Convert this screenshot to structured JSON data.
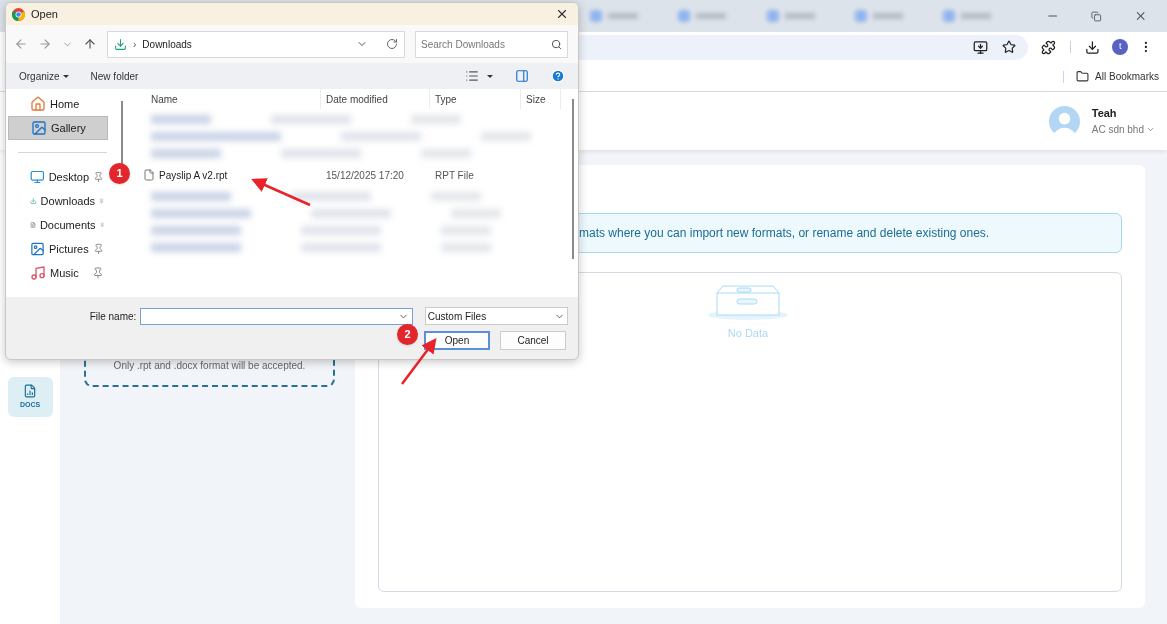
{
  "browser": {
    "profile_initial": "t",
    "bookmarks": [
      "All Bookmarks"
    ]
  },
  "app": {
    "user": {
      "name": "Teah",
      "company": "AC sdn bhd"
    },
    "sidebar": [
      {
        "label": "DOCS",
        "selected": true
      }
    ],
    "upload_hint": "Only .rpt and .docx format will be accepted.",
    "info_banner": "mats where you can import new formats, or rename and delete existing ones.",
    "empty_state": "No Data"
  },
  "dialog": {
    "title": "Open",
    "breadcrumb_separator": "›",
    "location": "Downloads",
    "search_placeholder": "Search Downloads",
    "toolbar": [
      {
        "label": "Organize",
        "dropdown": true
      },
      {
        "label": "New folder",
        "dropdown": false
      }
    ],
    "nav_top": [
      {
        "kind": "home",
        "label": "Home",
        "selected": false,
        "pinned": false
      },
      {
        "kind": "gallery",
        "label": "Gallery",
        "selected": true,
        "pinned": false
      }
    ],
    "nav_quick": [
      {
        "kind": "desktop",
        "label": "Desktop",
        "selected": false,
        "pinned": true
      },
      {
        "kind": "downloads",
        "label": "Downloads",
        "selected": false,
        "pinned": true
      },
      {
        "kind": "documents",
        "label": "Documents",
        "selected": false,
        "pinned": true
      },
      {
        "kind": "pictures",
        "label": "Pictures",
        "selected": false,
        "pinned": true
      },
      {
        "kind": "music",
        "label": "Music",
        "selected": false,
        "pinned": true
      }
    ],
    "columns": [
      "Name",
      "Date modified",
      "Type",
      "Size"
    ],
    "files": [
      {
        "name": "Payslip A v2.rpt",
        "date": "15/12/2025 17:20",
        "type": "RPT File"
      }
    ],
    "file_name_label": "File name:",
    "filter": "Custom Files",
    "buttons": [
      {
        "label": "Open",
        "kind": "primary"
      },
      {
        "label": "Cancel",
        "kind": "secondary"
      }
    ]
  },
  "annotations": [
    {
      "number": "1"
    },
    {
      "number": "2"
    }
  ]
}
